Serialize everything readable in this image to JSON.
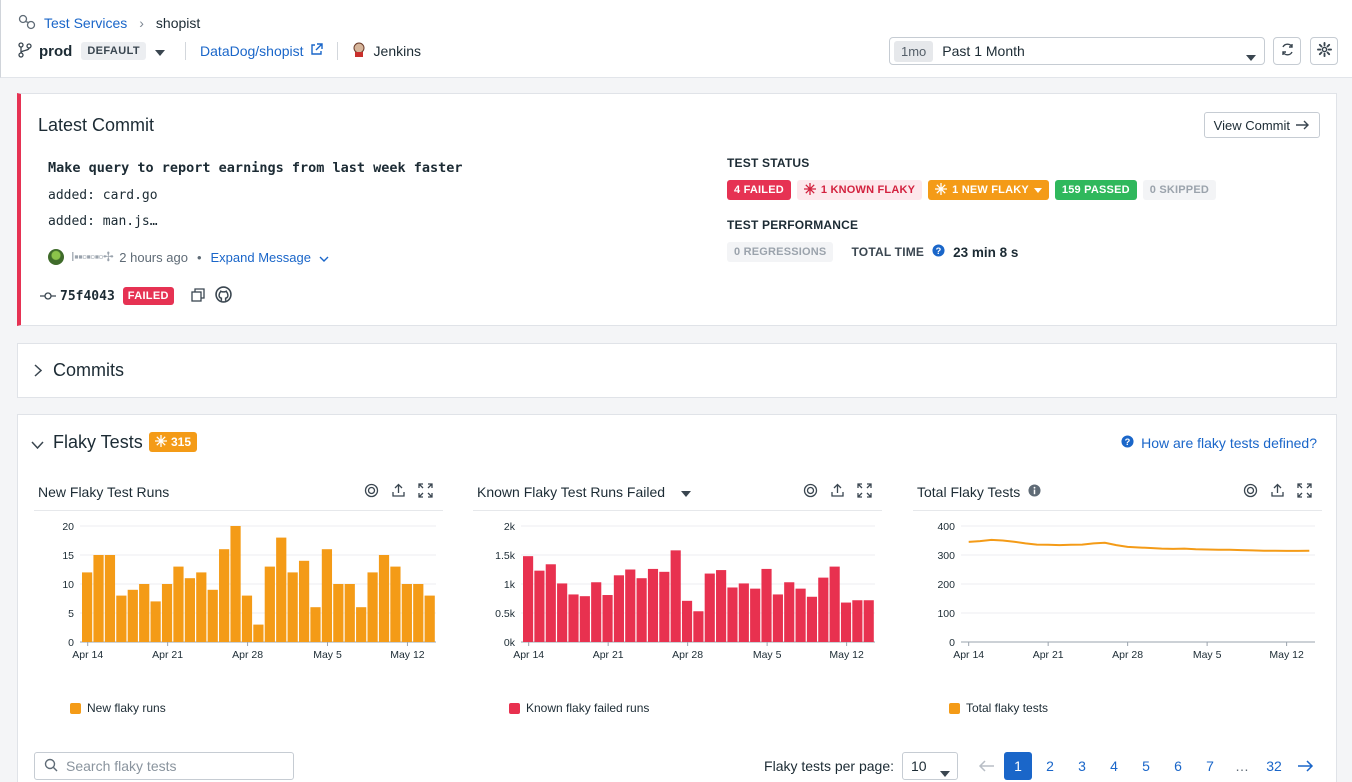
{
  "breadcrumb": {
    "parent": "Test Services",
    "current": "shopist"
  },
  "env": {
    "name": "prod",
    "default_tag": "DEFAULT",
    "repo": "DataDog/shopist",
    "ci_provider": "Jenkins"
  },
  "time_selector": {
    "tag": "1mo",
    "label": "Past 1 Month"
  },
  "latest_commit": {
    "title": "Latest Commit",
    "view_commit_label": "View Commit",
    "message_lines": [
      "Make query to report earnings from last week faster",
      "added: card.go",
      "added: man.js…"
    ],
    "author_masked": "I▪▪▫▪▫▪▫✢",
    "time_ago": "2 hours ago",
    "expand_label": "Expand Message",
    "sha": "75f4043",
    "status_tag": "FAILED",
    "test_status_heading": "TEST STATUS",
    "test_status": {
      "failed": "4 FAILED",
      "known_flaky": "1 KNOWN FLAKY",
      "new_flaky": "1 NEW FLAKY",
      "passed": "159 PASSED",
      "skipped": "0 SKIPPED"
    },
    "test_performance_heading": "TEST PERFORMANCE",
    "regressions": "0 REGRESSIONS",
    "total_time_label": "TOTAL TIME",
    "total_time_value": "23 min 8 s"
  },
  "commits_section": {
    "title": "Commits"
  },
  "flaky_section": {
    "title": "Flaky Tests",
    "count": "315",
    "help_link": "How are flaky tests defined?",
    "search_placeholder": "Search flaky tests",
    "per_page_label": "Flaky tests per page:",
    "per_page_value": "10",
    "pages": [
      "1",
      "2",
      "3",
      "4",
      "5",
      "6",
      "7",
      "…",
      "32"
    ],
    "active_page": "1"
  },
  "colors": {
    "accent": "#1a66c9",
    "orange": "#f49b17",
    "red": "#e8314f",
    "green": "#2fb85c"
  },
  "chart_data": [
    {
      "type": "bar",
      "title": "New Flaky Test Runs",
      "x_ticks": [
        "Apr 14",
        "Apr 21",
        "Apr 28",
        "May 5",
        "May 12"
      ],
      "y_ticks": [
        "0",
        "5",
        "10",
        "15",
        "20"
      ],
      "ylim": [
        0,
        20
      ],
      "series": [
        {
          "name": "New flaky runs",
          "color": "#f49b17",
          "values": [
            12,
            15,
            15,
            8,
            9,
            10,
            7,
            10,
            13,
            11,
            12,
            9,
            16,
            20,
            8,
            3,
            13,
            18,
            12,
            14,
            6,
            16,
            10,
            10,
            6,
            12,
            15,
            13,
            10,
            10,
            8
          ]
        }
      ]
    },
    {
      "type": "bar",
      "title": "Known Flaky Test Runs Failed",
      "x_ticks": [
        "Apr 14",
        "Apr 21",
        "Apr 28",
        "May 5",
        "May 12"
      ],
      "y_ticks": [
        "0k",
        "0.5k",
        "1k",
        "1.5k",
        "2k"
      ],
      "ylim": [
        0,
        2000
      ],
      "series": [
        {
          "name": "Known flaky failed runs",
          "color": "#e8314f",
          "values": [
            1480,
            1230,
            1340,
            1010,
            820,
            790,
            1030,
            810,
            1150,
            1250,
            1100,
            1260,
            1210,
            1580,
            710,
            530,
            1180,
            1240,
            940,
            1010,
            920,
            1260,
            820,
            1030,
            920,
            780,
            1110,
            1300,
            680,
            720,
            720
          ]
        }
      ]
    },
    {
      "type": "line",
      "title": "Total Flaky Tests",
      "x_ticks": [
        "Apr 14",
        "Apr 21",
        "Apr 28",
        "May 5",
        "May 12"
      ],
      "y_ticks": [
        "0",
        "100",
        "200",
        "300",
        "400"
      ],
      "ylim": [
        0,
        400
      ],
      "series": [
        {
          "name": "Total flaky tests",
          "color": "#f49b17",
          "values": [
            345,
            348,
            352,
            350,
            346,
            340,
            336,
            335,
            334,
            335,
            336,
            340,
            342,
            334,
            328,
            326,
            324,
            322,
            321,
            322,
            320,
            319,
            318,
            318,
            317,
            316,
            315,
            315,
            314,
            314,
            315
          ]
        }
      ]
    }
  ]
}
